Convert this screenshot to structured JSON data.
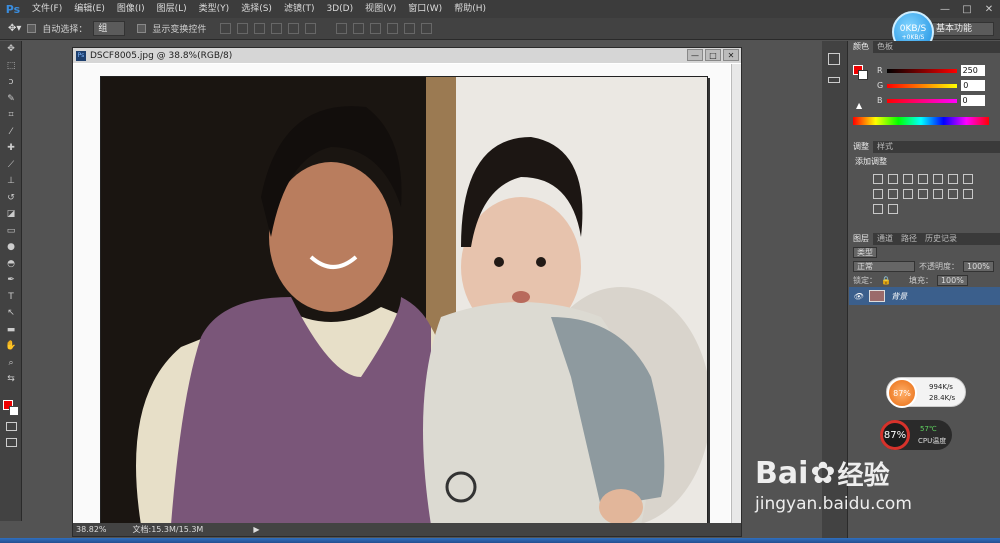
{
  "app": {
    "logo": "Ps",
    "menu": [
      "文件(F)",
      "编辑(E)",
      "图像(I)",
      "图层(L)",
      "类型(Y)",
      "选择(S)",
      "滤镜(T)",
      "3D(D)",
      "视图(V)",
      "窗口(W)",
      "帮助(H)"
    ],
    "window_controls": [
      "—",
      "□",
      "✕"
    ]
  },
  "options_bar": {
    "auto_select_label": "自动选择：",
    "auto_select_value": "组",
    "show_transform_label": "显示变换控件",
    "workspace": "基本功能"
  },
  "speed_bubble": {
    "main": "0KB/S",
    "sub": "+0KB/S"
  },
  "document": {
    "title": "DSCF8005.jpg @ 38.8%(RGB/8)",
    "ps_icon": "Ps",
    "zoom": "38.82%",
    "doc_size": "文档:15.3M/15.3M",
    "buttons": [
      "—",
      "□",
      "✕"
    ]
  },
  "color_panel": {
    "tabs": [
      "颜色",
      "色板"
    ],
    "rows": [
      {
        "label": "R",
        "value": "250",
        "color": "#ff2020"
      },
      {
        "label": "G",
        "value": "0",
        "color": "#20ff20"
      },
      {
        "label": "B",
        "value": "0",
        "color": "#2020ff"
      }
    ]
  },
  "adjust_panel": {
    "tabs": [
      "调整",
      "样式"
    ],
    "title": "添加调整"
  },
  "layers_panel": {
    "tabs": [
      "图层",
      "通道",
      "路径",
      "历史记录"
    ],
    "kind_label": "类型",
    "blend_mode": "正常",
    "opacity_label": "不透明度：",
    "opacity_value": "100%",
    "lock_label": "锁定：",
    "fill_label": "填充：",
    "fill_value": "100%",
    "layer_name": "背景"
  },
  "net_widget": {
    "percent": "87%",
    "up": "994K/s",
    "down": "28.4K/s"
  },
  "cpu_widget": {
    "percent": "87%",
    "temp": "57℃",
    "label": "CPU温度"
  },
  "watermark": {
    "brand": "Bai",
    "brand2": "经验",
    "url": "jingyan.baidu.com"
  },
  "colors": {
    "fg": "#e00000",
    "bg": "#ffffff",
    "layer_highlight": "#3b5f8c"
  }
}
